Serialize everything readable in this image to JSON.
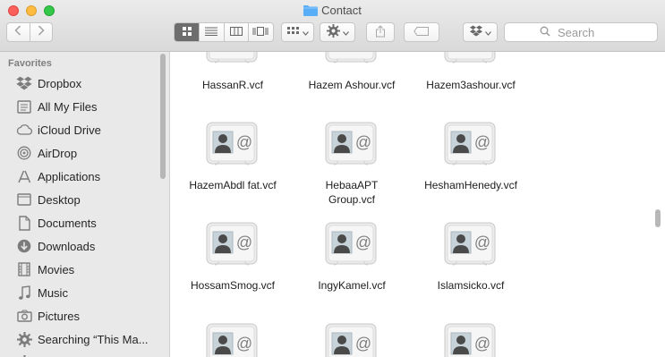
{
  "window": {
    "title": "Contact"
  },
  "toolbar": {
    "back_icon": "chevron-left-icon",
    "forward_icon": "chevron-right-icon",
    "view_modes": [
      "icon-view",
      "list-view",
      "column-view",
      "cover-flow-view"
    ],
    "active_view": "icon-view",
    "arrange_icon": "grid-arrange-icon",
    "action_icon": "gear-icon",
    "share_icon": "share-icon",
    "tag_icon": "tag-icon",
    "dropbox_icon": "dropbox-icon",
    "search_placeholder": "Search"
  },
  "sidebar": {
    "heading": "Favorites",
    "items": [
      {
        "label": "Dropbox",
        "icon": "dropbox-icon"
      },
      {
        "label": "All My Files",
        "icon": "all-files-icon"
      },
      {
        "label": "iCloud Drive",
        "icon": "cloud-icon"
      },
      {
        "label": "AirDrop",
        "icon": "airdrop-icon"
      },
      {
        "label": "Applications",
        "icon": "applications-icon"
      },
      {
        "label": "Desktop",
        "icon": "desktop-icon"
      },
      {
        "label": "Documents",
        "icon": "documents-icon"
      },
      {
        "label": "Downloads",
        "icon": "downloads-icon"
      },
      {
        "label": "Movies",
        "icon": "film-icon"
      },
      {
        "label": "Music",
        "icon": "music-note-icon"
      },
      {
        "label": "Pictures",
        "icon": "camera-icon"
      },
      {
        "label": "Searching “This Ma...",
        "icon": "smart-search-gear-icon"
      }
    ]
  },
  "files": [
    {
      "name": "HassanR.vcf"
    },
    {
      "name": "Hazem Ashour.vcf"
    },
    {
      "name": "Hazem3ashour.vcf"
    },
    {
      "name": "HazemAbdl fat.vcf"
    },
    {
      "name": "HebaaAPT Group.vcf"
    },
    {
      "name": "HeshamHenedy.vcf"
    },
    {
      "name": "HossamSmog.vcf"
    },
    {
      "name": "IngyKamel.vcf"
    },
    {
      "name": "Islamsicko.vcf"
    },
    {
      "name": ""
    },
    {
      "name": ""
    },
    {
      "name": ""
    }
  ],
  "colors": {
    "sidebar_bg": "#e9e9e9",
    "active_view": "#6d6d6d",
    "folder": "#5aaef7"
  }
}
